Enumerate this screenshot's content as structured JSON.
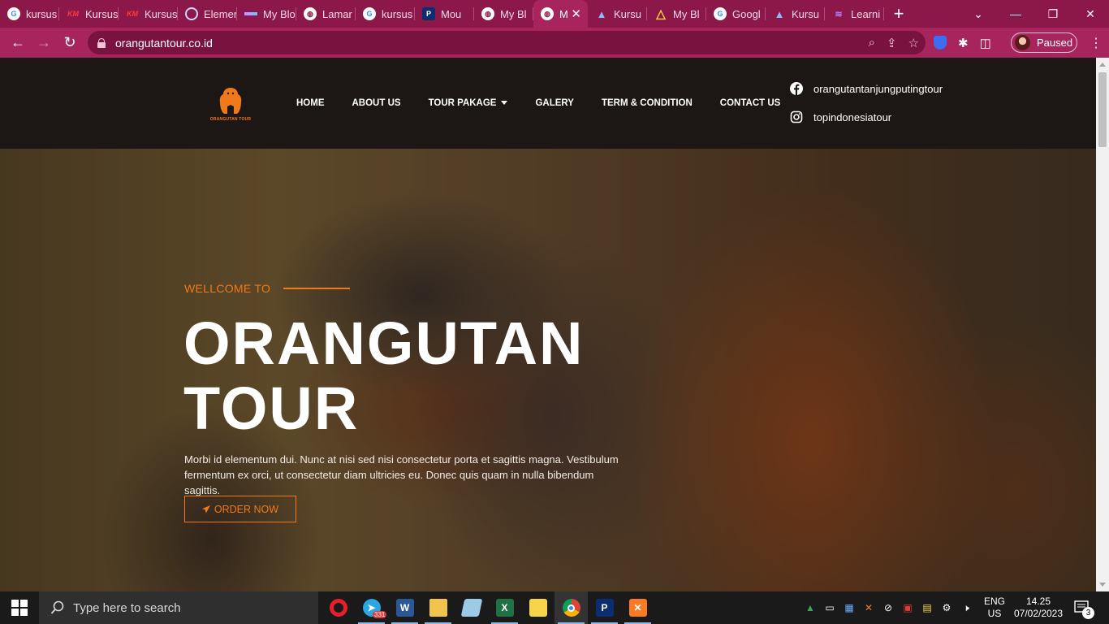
{
  "browser": {
    "tabs": [
      {
        "label": "kursus",
        "icon": "google-icon"
      },
      {
        "label": "Kursus",
        "icon": "km-icon"
      },
      {
        "label": "Kursus",
        "icon": "km-icon"
      },
      {
        "label": "Elemen",
        "icon": "loading-icon"
      },
      {
        "label": "My Blo",
        "icon": "wave-icon"
      },
      {
        "label": "Lamar",
        "icon": "globe-icon"
      },
      {
        "label": "kursus",
        "icon": "google-icon"
      },
      {
        "label": "Mou",
        "icon": "p-icon"
      },
      {
        "label": "My Bl",
        "icon": "globe-icon"
      },
      {
        "label": "M",
        "icon": "globe-icon",
        "active": true
      },
      {
        "label": "Kursu",
        "icon": "fin-icon"
      },
      {
        "label": "My Bl",
        "icon": "triangle-icon"
      },
      {
        "label": "Googl",
        "icon": "google-icon"
      },
      {
        "label": "Kursu",
        "icon": "fin-icon"
      },
      {
        "label": "Learni",
        "icon": "learn-icon"
      }
    ],
    "new_tab": "+",
    "url": "orangutantour.co.id",
    "profile_status": "Paused"
  },
  "site": {
    "logo_text": "ORANGUTAN TOUR",
    "nav": [
      "HOME",
      "ABOUT US",
      "TOUR PAKAGE",
      "GALERY",
      "TERM & CONDITION",
      "CONTACT US"
    ],
    "facebook": "orangutantanjungputingtour",
    "instagram": "topindonesiatour",
    "accent_color": "#f07a1a"
  },
  "hero": {
    "eyebrow": "WELLCOME TO",
    "title_line1": "ORANGUTAN",
    "title_line2": "TOUR",
    "text": "Morbi id elementum dui. Nunc at nisi sed nisi consectetur porta et sagittis magna. Vestibulum fermentum ex orci, ut consectetur diam ultricies eu. Donec quis quam in nulla bibendum sagittis.",
    "button": "ORDER NOW"
  },
  "taskbar": {
    "search_placeholder": "Type here to search",
    "telegram_badge": "331",
    "lang_top": "ENG",
    "lang_bottom": "US",
    "time": "14.25",
    "date": "07/02/2023",
    "notifications": "3"
  }
}
